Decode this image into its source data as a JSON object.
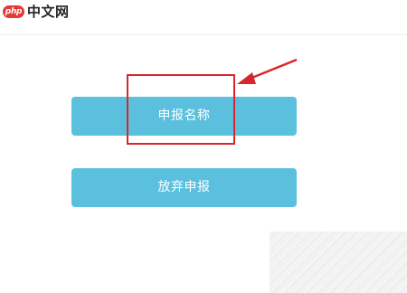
{
  "header": {
    "logo_badge": "php",
    "logo_text": "中文网"
  },
  "buttons": {
    "apply_name": "申报名称",
    "abandon_apply": "放弃申报"
  },
  "annotation": {
    "color": "#d9262c"
  },
  "colors": {
    "button_background": "#5bc0de",
    "logo_red": "#e53935"
  }
}
